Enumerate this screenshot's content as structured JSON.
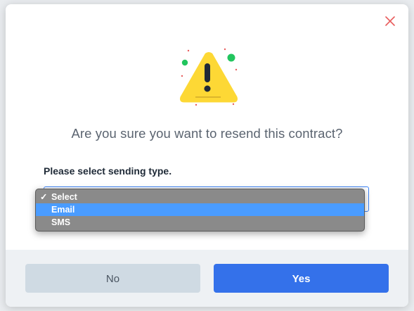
{
  "dialog": {
    "question": "Are you sure you want to resend this contract?",
    "select_label": "Please select sending type.",
    "close_icon": "close-icon",
    "warning_icon": "warning-triangle-icon"
  },
  "dropdown": {
    "selected_value": "Select",
    "highlighted_value": "Email",
    "options": [
      {
        "label": "Select",
        "checked": true
      },
      {
        "label": "Email",
        "checked": false
      },
      {
        "label": "SMS",
        "checked": false
      }
    ]
  },
  "footer": {
    "no_label": "No",
    "yes_label": "Yes"
  },
  "colors": {
    "accent": "#3471ea",
    "warning_yellow": "#fdd835",
    "close_red": "#e85d5d",
    "highlight": "#4a9cff"
  }
}
